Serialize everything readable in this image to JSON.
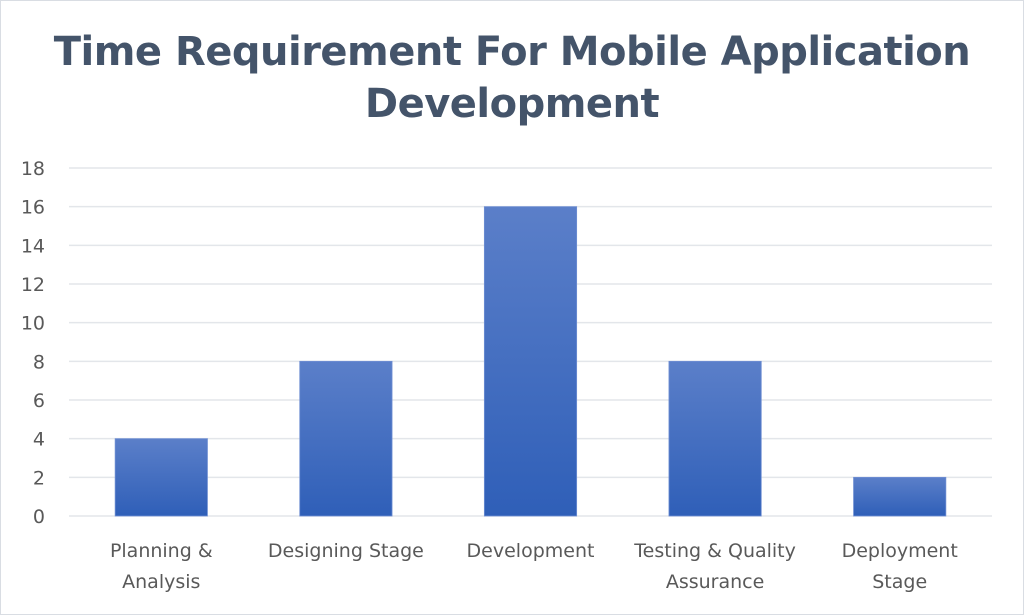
{
  "chart_data": {
    "type": "bar",
    "title": "Time Requirement For Mobile Application Development",
    "title_lines": [
      "Time Requirement For Mobile Application",
      "Development"
    ],
    "categories": [
      "Planning & Analysis",
      "Designing Stage",
      "Development",
      "Testing & Quality Assurance",
      "Deployment Stage"
    ],
    "category_lines": [
      [
        "Planning &",
        "Analysis"
      ],
      [
        "Designing Stage"
      ],
      [
        "Development"
      ],
      [
        "Testing & Quality",
        "Assurance"
      ],
      [
        "Deployment",
        "Stage"
      ]
    ],
    "values": [
      4,
      8,
      16,
      8,
      2
    ],
    "xlabel": "",
    "ylabel": "",
    "ylim": [
      0,
      18
    ],
    "yticks": [
      0,
      2,
      4,
      6,
      8,
      10,
      12,
      14,
      16,
      18
    ],
    "grid": true,
    "legend": "none",
    "colors": {
      "bar_top": "#5b7fc9",
      "bar_bottom": "#2f5fb8",
      "grid": "#e3e6ea",
      "text": "#595959",
      "title": "#44546a"
    }
  }
}
